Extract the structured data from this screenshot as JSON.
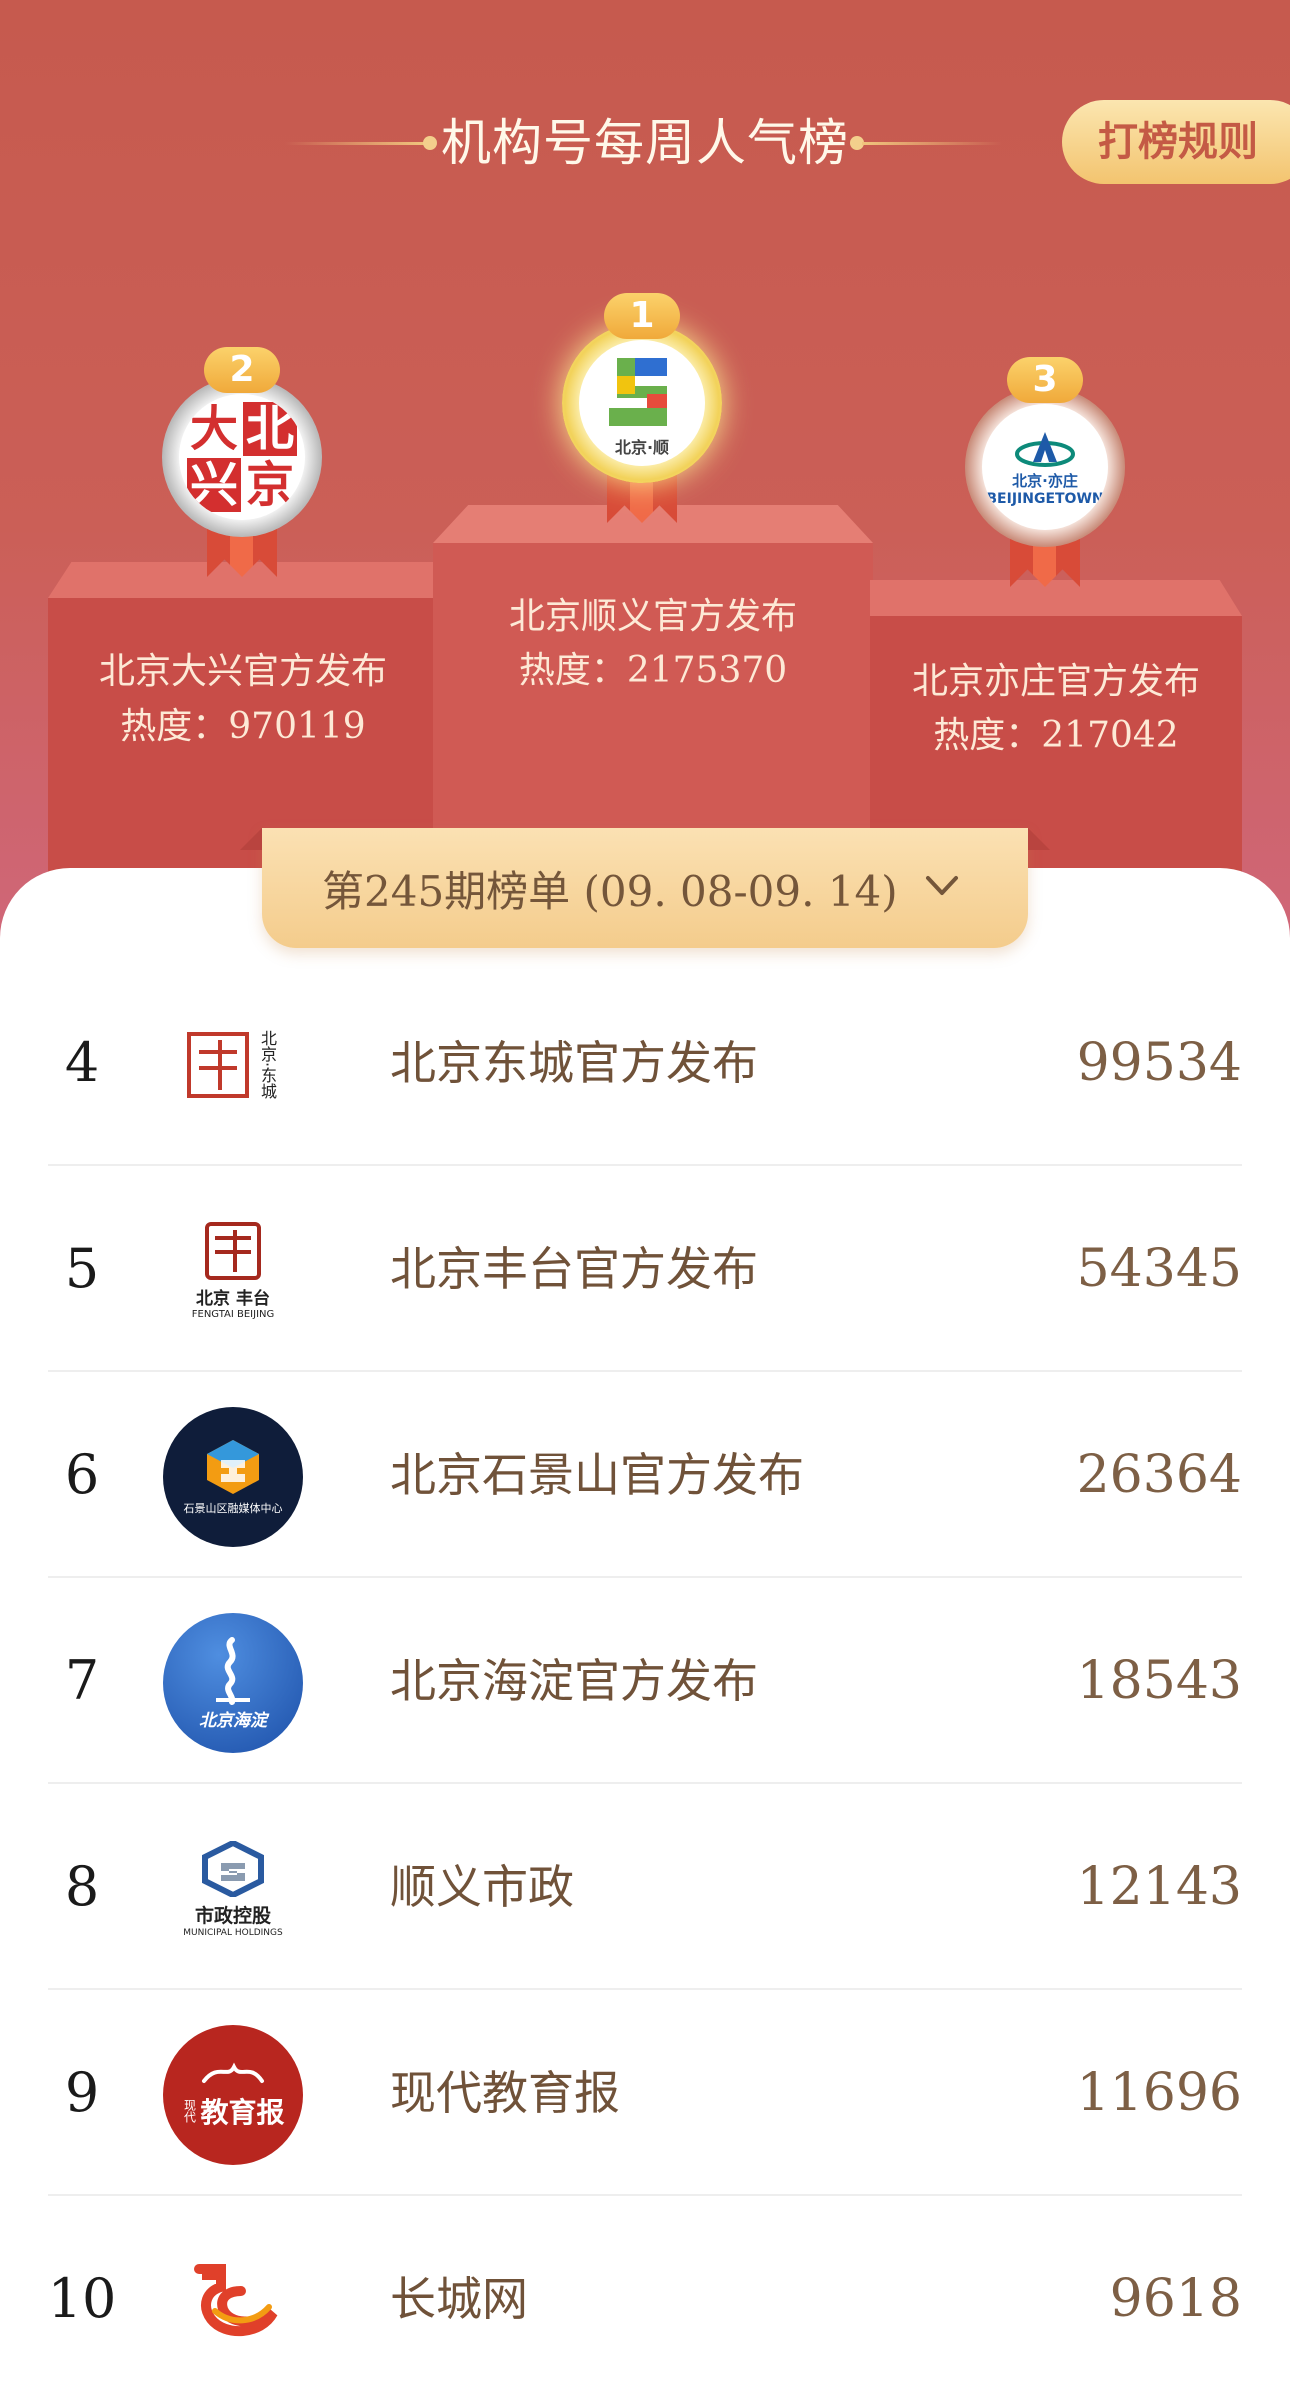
{
  "header": {
    "title": "机构号每周人气榜",
    "rules_button": "打榜规则"
  },
  "podium": [
    {
      "rank": "1",
      "name": "北京顺义官方发布",
      "heat": "热度：2175370"
    },
    {
      "rank": "2",
      "name": "北京大兴官方发布",
      "heat": "热度：970119"
    },
    {
      "rank": "3",
      "name": "北京亦庄官方发布",
      "heat": "热度：217042"
    }
  ],
  "medal_logos": {
    "dx": [
      "大",
      "北",
      "兴",
      "京"
    ],
    "sy": "北京·顺",
    "yz_top": "北京·亦庄",
    "yz_bottom": "BEIJINGETOWN"
  },
  "period": {
    "label": "第245期榜单 (09. 08-09. 14)"
  },
  "list": [
    {
      "rank": "4",
      "name": "北京东城官方发布",
      "score": "99534"
    },
    {
      "rank": "5",
      "name": "北京丰台官方发布",
      "score": "54345"
    },
    {
      "rank": "6",
      "name": "北京石景山官方发布",
      "score": "26364"
    },
    {
      "rank": "7",
      "name": "北京海淀官方发布",
      "score": "18543"
    },
    {
      "rank": "8",
      "name": "顺义市政",
      "score": "12143"
    },
    {
      "rank": "9",
      "name": "现代教育报",
      "score": "11696"
    },
    {
      "rank": "10",
      "name": "长城网",
      "score": "9618"
    }
  ],
  "list_logos": {
    "dc": "北京·东城",
    "ft_top": "北京 丰台",
    "ft_bottom": "FENGTAI BEIJING",
    "sjs": "石景山区融媒体中心",
    "hd": "北京海淀",
    "symz": "市政控股",
    "symz_sub": "MUNICIPAL HOLDINGS",
    "xd_small": "现代",
    "xd_big": "教育报"
  },
  "colors": {
    "hero_bg": "#c65a4e",
    "gold": "#f3c46f",
    "text_brown": "#705239"
  }
}
